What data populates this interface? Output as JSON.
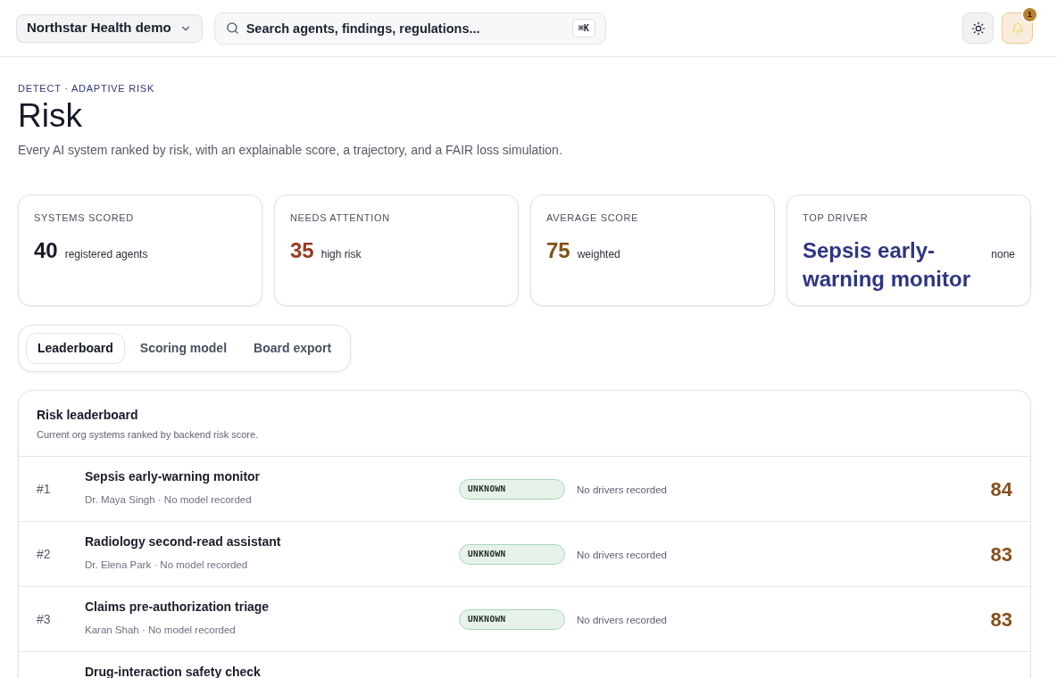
{
  "topbar": {
    "workspace": "Northstar Health demo",
    "search": {
      "placeholder": "Search agents, findings, regulations...",
      "shortcut": "⌘K"
    },
    "notifications": {
      "count": "1"
    }
  },
  "header": {
    "eyebrow": "DETECT · ADAPTIVE RISK",
    "title": "Risk",
    "description": "Every AI system ranked by risk, with an explainable score, a trajectory, and a FAIR loss simulation."
  },
  "stats": [
    {
      "label": "SYSTEMS SCORED",
      "value": "40",
      "caption": "registered agents",
      "color": "#161927"
    },
    {
      "label": "NEEDS ATTENTION",
      "value": "35",
      "caption": "high risk",
      "color": "#9a3b22"
    },
    {
      "label": "AVERAGE SCORE",
      "value": "75",
      "caption": "weighted",
      "color": "#80501a"
    },
    {
      "label": "TOP DRIVER",
      "value": "Sepsis early-warning monitor",
      "caption": "none",
      "color": "#2f3582"
    }
  ],
  "tabs": [
    {
      "label": "Leaderboard",
      "selected": true
    },
    {
      "label": "Scoring model",
      "selected": false
    },
    {
      "label": "Board export",
      "selected": false
    }
  ],
  "leaderboard": {
    "title": "Risk leaderboard",
    "subtitle": "Current org systems ranked by backend risk score.",
    "rows": [
      {
        "rank": "#1",
        "name": "Sepsis early-warning monitor",
        "meta": "Dr. Maya Singh · No model recorded",
        "status": "UNKNOWN",
        "drivers": "No drivers recorded",
        "score": "84"
      },
      {
        "rank": "#2",
        "name": "Radiology second-read assistant",
        "meta": "Dr. Elena Park · No model recorded",
        "status": "UNKNOWN",
        "drivers": "No drivers recorded",
        "score": "83"
      },
      {
        "rank": "#3",
        "name": "Claims pre-authorization triage",
        "meta": "Karan Shah · No model recorded",
        "status": "UNKNOWN",
        "drivers": "No drivers recorded",
        "score": "83"
      },
      {
        "name": "Drug-interaction safety check"
      }
    ]
  }
}
